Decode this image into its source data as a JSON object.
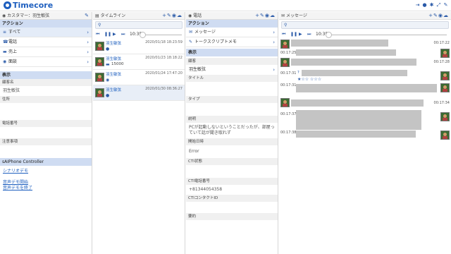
{
  "app": {
    "name": "Timecore"
  },
  "topbar": {
    "icons": [
      "logout-icon",
      "user-icon",
      "gear-icon",
      "expand-icon",
      "pin-icon"
    ]
  },
  "col1": {
    "header": "カスタマー：羽生敏弦",
    "actions_title": "アクション",
    "nav": [
      {
        "label": "すべて",
        "icon": "≡"
      },
      {
        "label": "電話",
        "icon": "☎"
      },
      {
        "label": "売上",
        "icon": "▬"
      },
      {
        "label": "面談",
        "icon": "◉"
      }
    ],
    "display_title": "表示",
    "fields": [
      {
        "label": "顧客名",
        "value": "羽生敏弦"
      },
      {
        "label": "住所",
        "value": ""
      },
      {
        "label": "電話番号",
        "value": ""
      },
      {
        "label": "注意事項",
        "value": ""
      }
    ],
    "sai_title": "sAIPhone Controller",
    "links": [
      "シナリオデモ",
      "音声デモ開始",
      "音声デモを終了"
    ]
  },
  "col2": {
    "header": "タイムライン",
    "time": "10:35",
    "items": [
      {
        "name": "羽生敏弦",
        "date": "2020/01/18 18:23:59",
        "extra": ""
      },
      {
        "name": "羽生敏弦",
        "date": "2020/01/23 18:18:22",
        "extra": "15000"
      },
      {
        "name": "羽生敏弦",
        "date": "2020/01/24 17:47:20",
        "extra": ""
      },
      {
        "name": "羽生敏弦",
        "date": "2020/01/30 08:36:27",
        "extra": ""
      }
    ]
  },
  "col3": {
    "header": "電話",
    "actions_title": "アクション",
    "nav": [
      {
        "label": "メッセージ",
        "icon": "✉"
      },
      {
        "label": "トークスクリプトメモ",
        "icon": "✎"
      }
    ],
    "display_title": "表示",
    "customer_label": "顧客",
    "customer_value": "羽生敏弦",
    "fields": [
      {
        "label": "タイトル",
        "value": ""
      },
      {
        "label": "タイプ",
        "value": ""
      },
      {
        "label": "説明",
        "value": "PCが起動しないということだったが、部屋っていて話が聞き取れず"
      },
      {
        "label": "開始日時",
        "value": "Error"
      },
      {
        "label": "CTI状態",
        "value": ""
      },
      {
        "label": "CTI電話番号",
        "value": "+81344054358"
      },
      {
        "label": "CTIコンタクトID",
        "value": ""
      },
      {
        "label": "要約",
        "value": ""
      }
    ]
  },
  "col4": {
    "header": "メッセージ",
    "time": "10:35",
    "times": [
      "00:17:22",
      "00:17:25",
      "00:17:28",
      "00:17:31",
      "00:17:31",
      "00:17:34",
      "00:17:37",
      "00:17:38"
    ],
    "stars": "★☆☆ ☆☆☆"
  },
  "colors": {
    "accent": "#1e5fbf",
    "section": "#cfdcf2"
  }
}
